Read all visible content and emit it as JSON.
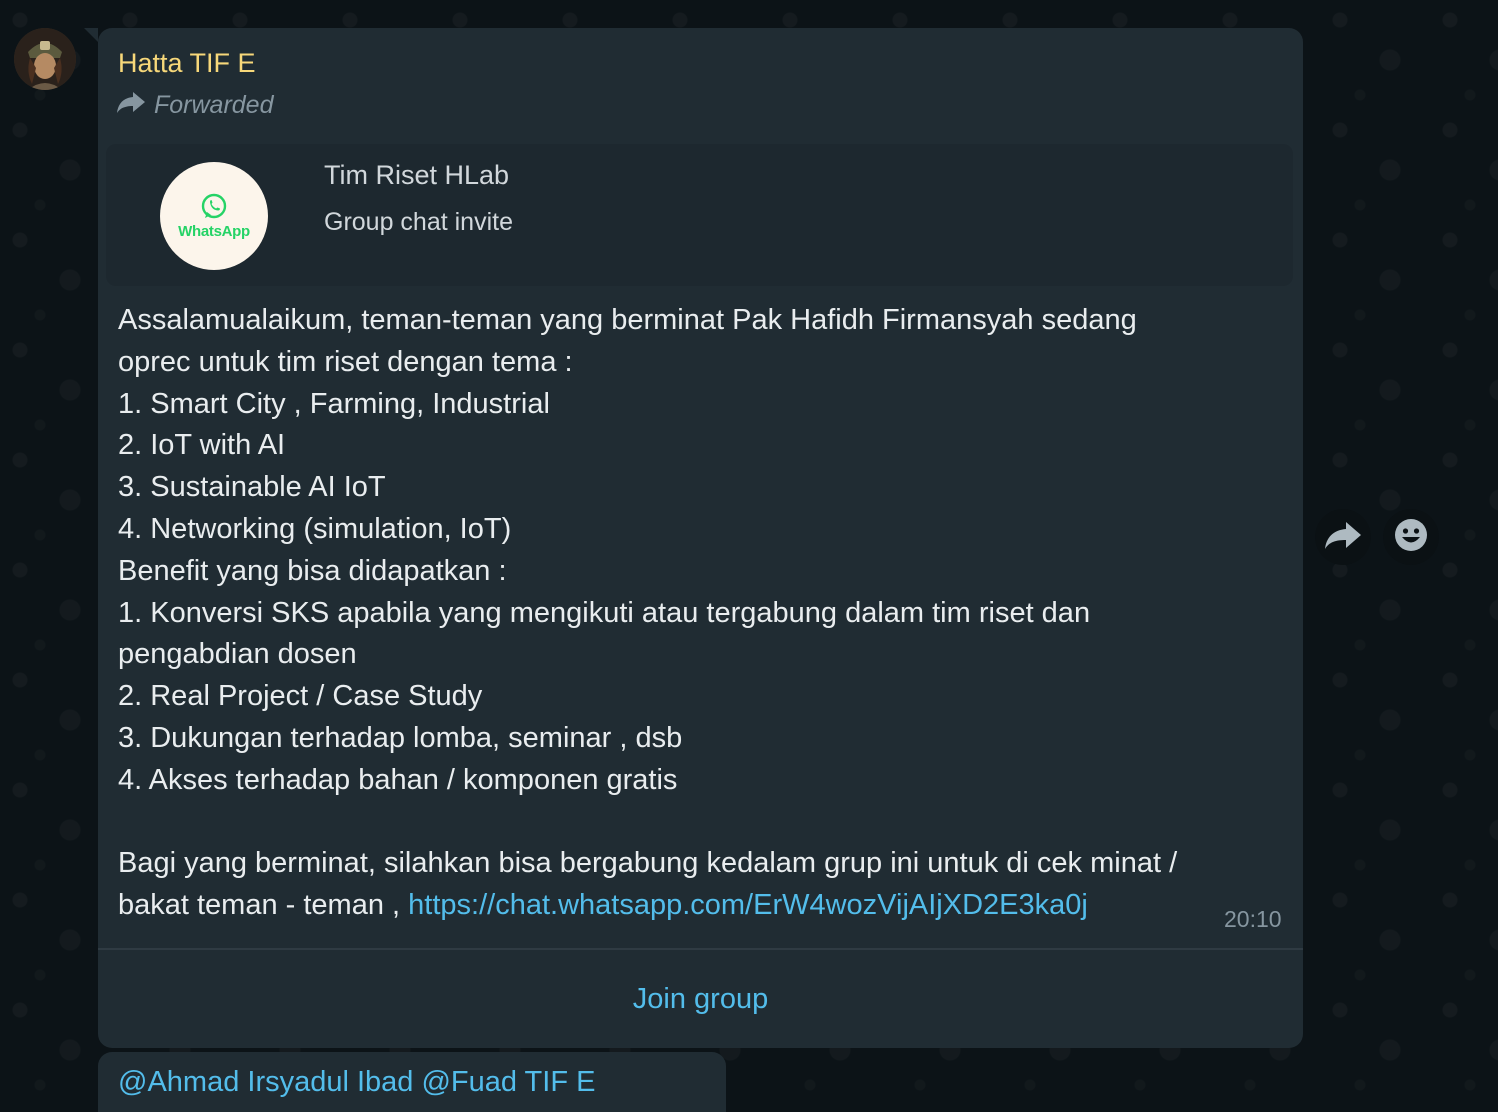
{
  "message": {
    "sender": "Hatta TIF E",
    "forwarded_label": "Forwarded",
    "invite": {
      "group_name": "Tim Riset HLab",
      "subtitle": "Group chat invite",
      "logo_text": "WhatsApp"
    },
    "body_lines": [
      "Assalamualaikum, teman-teman yang berminat Pak Hafidh Firmansyah sedang",
      "oprec untuk tim riset dengan tema :",
      "1. Smart City , Farming, Industrial",
      "2. IoT with AI",
      "3. Sustainable AI IoT",
      "4. Networking (simulation, IoT)",
      "Benefit yang bisa didapatkan :",
      "1. Konversi SKS apabila yang mengikuti atau tergabung dalam tim riset dan",
      "pengabdian dosen",
      "2. Real Project / Case Study",
      "3. Dukungan terhadap lomba, seminar , dsb",
      "4. Akses terhadap bahan / komponen gratis",
      "",
      "Bagi yang berminat, silahkan bisa bergabung kedalam grup ini untuk di cek minat /"
    ],
    "last_line_text": "bakat teman - teman , ",
    "link": "https://chat.whatsapp.com/ErW4wozVijAIjXD2E3ka0j",
    "time": "20:10",
    "join_button": "Join group"
  },
  "next_message": {
    "text": "@Ahmad Irsyadul Ibad @Fuad TIF E"
  },
  "icons": {
    "forward": "forward-arrow-icon",
    "react": "emoji-smile-icon",
    "logo": "whatsapp-logo-icon"
  },
  "colors": {
    "sender": "#f7d87a",
    "link": "#53bdeb",
    "bubble": "#202c33",
    "background": "#0c1317"
  }
}
